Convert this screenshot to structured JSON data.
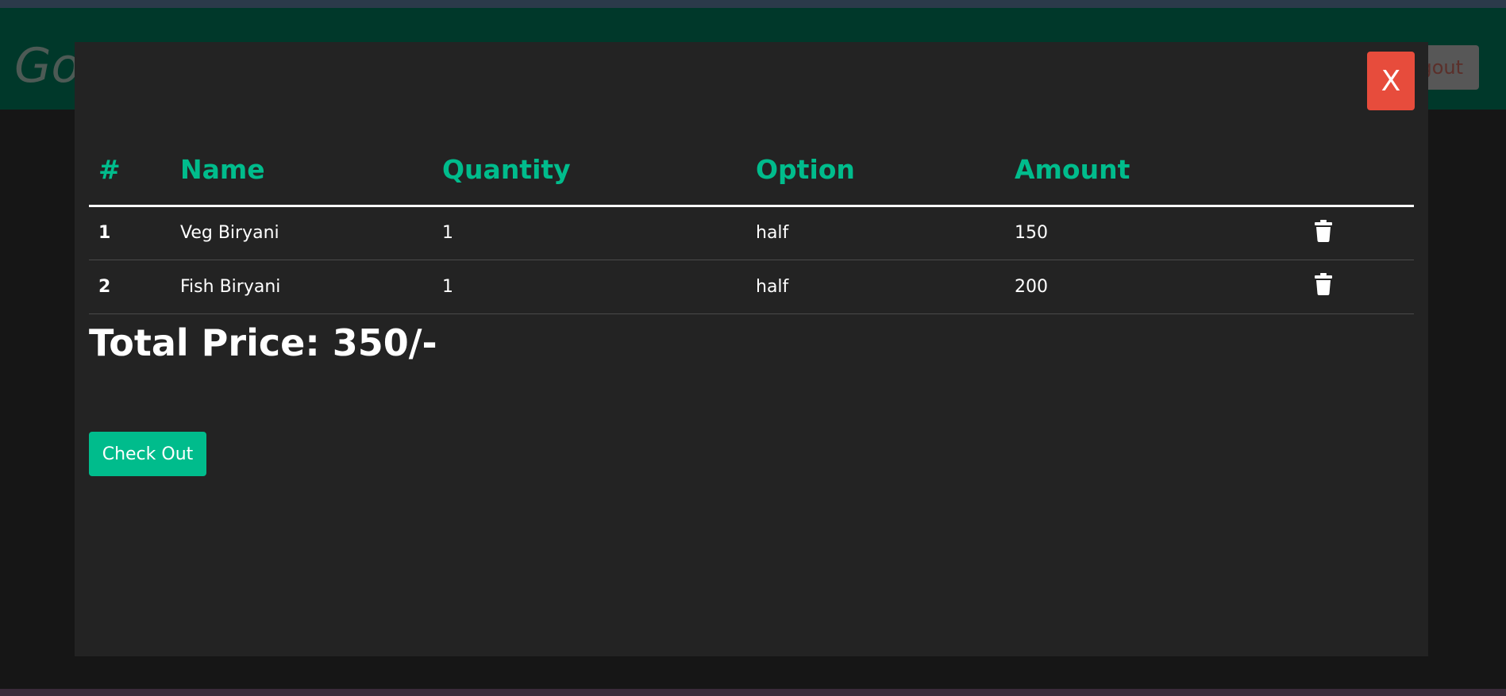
{
  "navbar": {
    "brand": "Go",
    "cart_label": "",
    "logout_label": "gout"
  },
  "modal": {
    "close_label": "X",
    "table": {
      "headers": [
        "#",
        "Name",
        "Quantity",
        "Option",
        "Amount"
      ],
      "rows": [
        {
          "index": "1",
          "name": "Veg Biryani",
          "quantity": "1",
          "option": "half",
          "amount": "150"
        },
        {
          "index": "2",
          "name": "Fish Biryani",
          "quantity": "1",
          "option": "half",
          "amount": "200"
        }
      ]
    },
    "total": "Total Price: 350/-",
    "checkout_label": "Check Out"
  },
  "colors": {
    "accent": "#00bc8c",
    "danger": "#e74c3c",
    "modal_bg": "#232323",
    "navbar_bg": "#00382a"
  },
  "icons": {
    "delete": "trash-icon"
  }
}
